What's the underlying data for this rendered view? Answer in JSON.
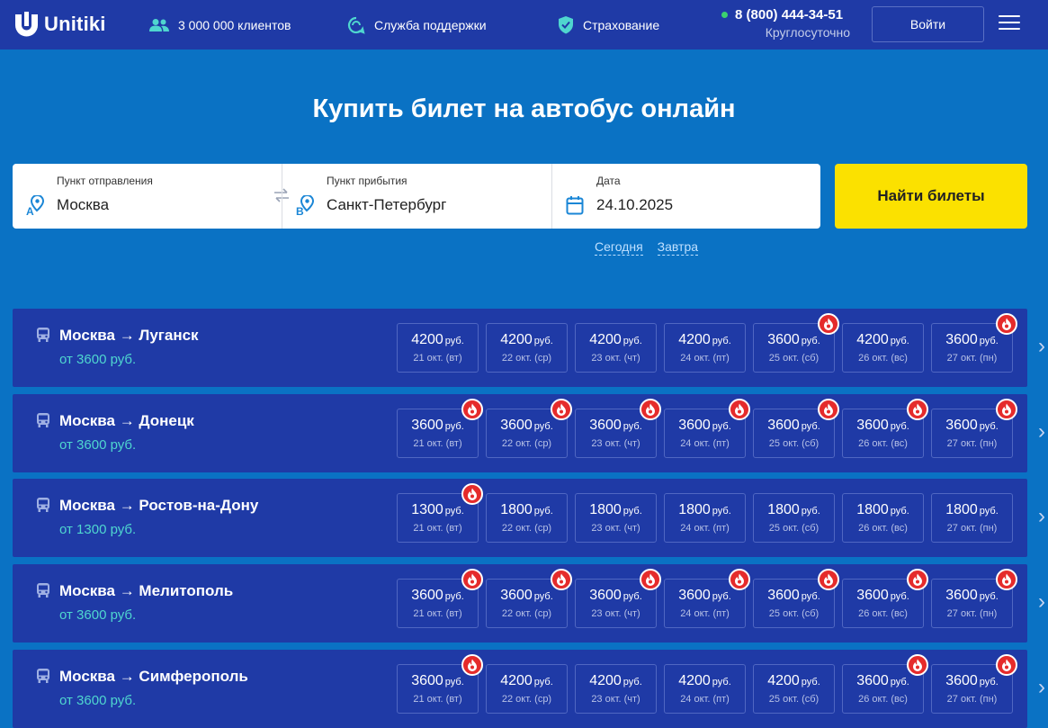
{
  "header": {
    "logo_text": "Unitiki",
    "clients": "3 000 000 клиентов",
    "support": "Служба поддержки",
    "insurance": "Страхование",
    "phone": "8 (800) 444-34-51",
    "phone_sub": "Круглосуточно",
    "login": "Войти"
  },
  "hero": {
    "title": "Купить билет на автобус онлайн"
  },
  "search": {
    "from_label": "Пункт отправления",
    "from_value": "Москва",
    "to_label": "Пункт прибытия",
    "to_value": "Санкт-Петербург",
    "date_label": "Дата",
    "date_value": "24.10.2025",
    "find_button": "Найти билеты",
    "today": "Сегодня",
    "tomorrow": "Завтра"
  },
  "currency": "руб.",
  "routes": [
    {
      "title": "Москва → Луганск",
      "from_price": "от 3600 руб.",
      "days": [
        {
          "price": "4200",
          "date": "21 окт. (вт)",
          "hot": false
        },
        {
          "price": "4200",
          "date": "22 окт. (ср)",
          "hot": false
        },
        {
          "price": "4200",
          "date": "23 окт. (чт)",
          "hot": false
        },
        {
          "price": "4200",
          "date": "24 окт. (пт)",
          "hot": false
        },
        {
          "price": "3600",
          "date": "25 окт. (сб)",
          "hot": true
        },
        {
          "price": "4200",
          "date": "26 окт. (вс)",
          "hot": false
        },
        {
          "price": "3600",
          "date": "27 окт. (пн)",
          "hot": true
        }
      ]
    },
    {
      "title": "Москва → Донецк",
      "from_price": "от 3600 руб.",
      "days": [
        {
          "price": "3600",
          "date": "21 окт. (вт)",
          "hot": true
        },
        {
          "price": "3600",
          "date": "22 окт. (ср)",
          "hot": true
        },
        {
          "price": "3600",
          "date": "23 окт. (чт)",
          "hot": true
        },
        {
          "price": "3600",
          "date": "24 окт. (пт)",
          "hot": true
        },
        {
          "price": "3600",
          "date": "25 окт. (сб)",
          "hot": true
        },
        {
          "price": "3600",
          "date": "26 окт. (вс)",
          "hot": true
        },
        {
          "price": "3600",
          "date": "27 окт. (пн)",
          "hot": true
        }
      ]
    },
    {
      "title": "Москва → Ростов-на-Дону",
      "from_price": "от 1300 руб.",
      "days": [
        {
          "price": "1300",
          "date": "21 окт. (вт)",
          "hot": true
        },
        {
          "price": "1800",
          "date": "22 окт. (ср)",
          "hot": false
        },
        {
          "price": "1800",
          "date": "23 окт. (чт)",
          "hot": false
        },
        {
          "price": "1800",
          "date": "24 окт. (пт)",
          "hot": false
        },
        {
          "price": "1800",
          "date": "25 окт. (сб)",
          "hot": false
        },
        {
          "price": "1800",
          "date": "26 окт. (вс)",
          "hot": false
        },
        {
          "price": "1800",
          "date": "27 окт. (пн)",
          "hot": false
        }
      ]
    },
    {
      "title": "Москва → Мелитополь",
      "from_price": "от 3600 руб.",
      "days": [
        {
          "price": "3600",
          "date": "21 окт. (вт)",
          "hot": true
        },
        {
          "price": "3600",
          "date": "22 окт. (ср)",
          "hot": true
        },
        {
          "price": "3600",
          "date": "23 окт. (чт)",
          "hot": true
        },
        {
          "price": "3600",
          "date": "24 окт. (пт)",
          "hot": true
        },
        {
          "price": "3600",
          "date": "25 окт. (сб)",
          "hot": true
        },
        {
          "price": "3600",
          "date": "26 окт. (вс)",
          "hot": true
        },
        {
          "price": "3600",
          "date": "27 окт. (пн)",
          "hot": true
        }
      ]
    },
    {
      "title": "Москва → Симферополь",
      "from_price": "от 3600 руб.",
      "days": [
        {
          "price": "3600",
          "date": "21 окт. (вт)",
          "hot": true
        },
        {
          "price": "4200",
          "date": "22 окт. (ср)",
          "hot": false
        },
        {
          "price": "4200",
          "date": "23 окт. (чт)",
          "hot": false
        },
        {
          "price": "4200",
          "date": "24 окт. (пт)",
          "hot": false
        },
        {
          "price": "4200",
          "date": "25 окт. (сб)",
          "hot": false
        },
        {
          "price": "3600",
          "date": "26 окт. (вс)",
          "hot": true
        },
        {
          "price": "3600",
          "date": "27 окт. (пн)",
          "hot": true
        }
      ]
    }
  ]
}
